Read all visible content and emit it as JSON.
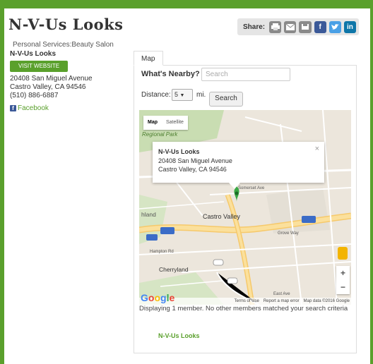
{
  "header": {
    "title": "N-V-Us Looks",
    "share_label": "Share:",
    "share_buttons": [
      {
        "icon": "print-icon",
        "label": ""
      },
      {
        "icon": "email-icon",
        "label": ""
      },
      {
        "icon": "save-icon",
        "label": ""
      },
      {
        "icon": "facebook-icon",
        "label": "f"
      },
      {
        "icon": "twitter-icon",
        "label": "t"
      },
      {
        "icon": "linkedin-icon",
        "label": "in"
      }
    ]
  },
  "sidebar": {
    "category": "Personal Services:Beauty Salon",
    "business_name": "N-V-Us Looks",
    "visit_label": "VISIT WEBSITE",
    "address_line1": "20408 San Miguel Avenue",
    "address_line2": "Castro Valley, CA 94546",
    "phone": "(510) 886-6887",
    "facebook_label": "Facebook"
  },
  "panel": {
    "tab_label": "Map",
    "nearby_label": "What's Nearby?",
    "search_placeholder": "Search",
    "distance_label": "Distance:",
    "distance_value": "5",
    "distance_unit": "mi.",
    "search_button": "Search"
  },
  "map": {
    "type_map": "Map",
    "type_satellite": "Satellite",
    "info_name": "N-V-Us Looks",
    "info_addr1": "20408 San Miguel Avenue",
    "info_addr2": "Castro Valley, CA 94546",
    "close": "×",
    "labels": {
      "regional_park": "Regional Park",
      "castro_valley": "Castro Valley",
      "cherryland": "Cherryland",
      "highland": "hland",
      "grove_way": "Grove Way",
      "hampton": "Hampton Rd",
      "somerset": "Somerset Ave",
      "east_ave": "East Ave"
    },
    "footer_terms": "Terms of Use",
    "footer_report": "Report a map error",
    "footer_data": "Map data ©2016 Google",
    "zoom_in": "+",
    "zoom_out": "−"
  },
  "results": {
    "message": "Displaying 1 member. No other members matched your search criteria",
    "member_name": "N-V-Us Looks"
  },
  "colors": {
    "accent": "#5aa02c"
  }
}
